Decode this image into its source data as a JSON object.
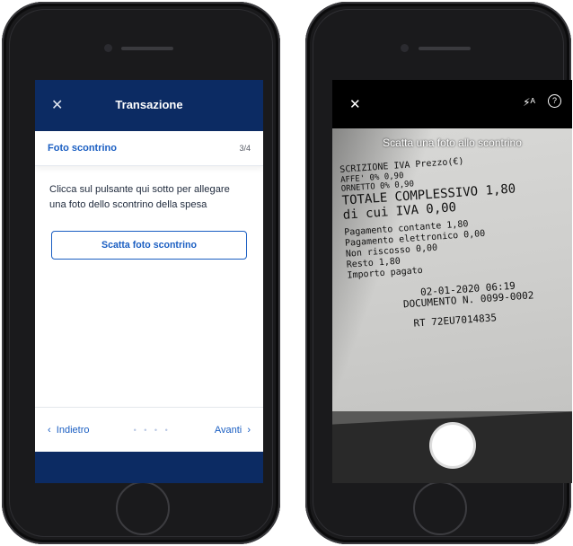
{
  "left_screen": {
    "header": {
      "close_icon": "close-icon",
      "title": "Transazione"
    },
    "step": {
      "title": "Foto scontrino",
      "count": "3/4"
    },
    "instruction": "Clicca sul pulsante qui sotto per allegare una foto dello scontrino della spesa",
    "primary_button": "Scatta foto scontrino",
    "nav": {
      "back": "Indietro",
      "next": "Avanti",
      "dots": "• • • •"
    }
  },
  "right_screen": {
    "caption": "Scatta una foto allo scontrino",
    "help_glyph": "?",
    "receipt_lines": [
      "SCRIZIONE        IVA  Prezzo(€)",
      "AFFE'            0%      0,90",
      "ORNETTO          0%      0,90",
      "TOTALE COMPLESSIVO       1,80",
      "di cui IVA               0,00",
      "Pagamento contante       1,80",
      "Pagamento elettronico    0,00",
      "Non riscosso             0,00",
      "Resto                    1,80",
      "Importo pagato",
      "02-01-2020  06:19",
      "DOCUMENTO N. 0099-0002",
      "RT  72EU7014835"
    ]
  }
}
